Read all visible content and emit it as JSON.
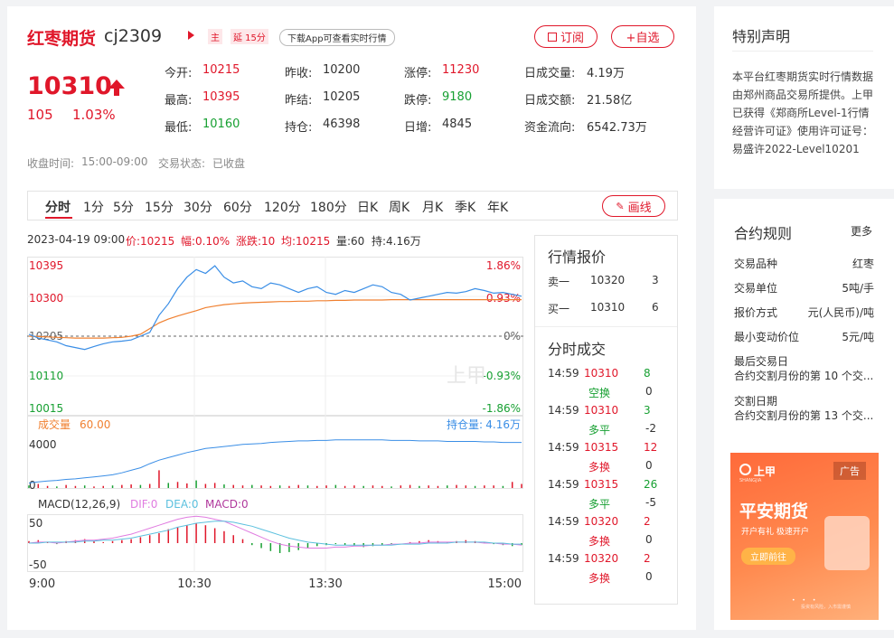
{
  "header": {
    "name": "红枣期货",
    "code": "cj2309",
    "badge_main": "主",
    "badge_delay": "延 15分",
    "download_hint": "下载App可查看实时行情",
    "subscribe_label": "订阅",
    "add_fav_label": "+自选"
  },
  "price": {
    "last": "10310",
    "change": "105",
    "change_pct": "1.03%",
    "up_color": "#e0172a",
    "down_color": "#17a032"
  },
  "stats": {
    "open_label": "今开:",
    "open": "10215",
    "prev_close_label": "昨收:",
    "prev_close": "10200",
    "limit_up_label": "涨停:",
    "limit_up": "11230",
    "volume_label": "日成交量:",
    "volume": "4.19万",
    "high_label": "最高:",
    "high": "10395",
    "prev_settle_label": "昨结:",
    "prev_settle": "10205",
    "limit_down_label": "跌停:",
    "limit_down": "9180",
    "turnover_label": "日成交额:",
    "turnover": "21.58亿",
    "low_label": "最低:",
    "low": "10160",
    "open_interest_label": "持仓:",
    "open_interest": "46398",
    "daily_inc_label": "日增:",
    "daily_inc": "4845",
    "fund_flow_label": "资金流向:",
    "fund_flow": "6542.73万"
  },
  "session": {
    "close_time_label": "收盘时间:",
    "close_time": "15:00-09:00",
    "trade_status_label": "交易状态:",
    "trade_status": "已收盘"
  },
  "tabs": [
    "分时",
    "1分",
    "5分",
    "15分",
    "30分",
    "60分",
    "120分",
    "180分",
    "日K",
    "周K",
    "月K",
    "季K",
    "年K"
  ],
  "draw_line_label": "画线",
  "info_bar": {
    "datetime": "2023-04-19 09:00",
    "price": "价:10215",
    "amplitude": "幅:0.10%",
    "change": "涨跌:10",
    "average": "均:10215",
    "volume": "量:60",
    "hold": "持:4.16万"
  },
  "chart_data": {
    "type": "line",
    "price_axis": {
      "left": [
        "10395",
        "10300",
        "10205",
        "10110",
        "10015"
      ],
      "right": [
        "1.86%",
        "0.93%",
        "0%",
        "-0.93%",
        "-1.86%"
      ],
      "ylim": [
        10015,
        10395
      ]
    },
    "x_ticks": [
      "9:00",
      "10:30",
      "13:30",
      "15:00"
    ],
    "volume_label": "成交量",
    "volume_value": "60.00",
    "hold_label": "持仓量:",
    "hold_value": "4.16万",
    "volume_axis": [
      "4000",
      "0"
    ],
    "macd_label": "MACD(12,26,9)",
    "dif_label": "DIF:0",
    "dea_label": "DEA:0",
    "macd_value_label": "MACD:0",
    "macd_axis": [
      "50",
      "-50"
    ],
    "series": [
      {
        "name": "价",
        "color": "#3a8ee6",
        "values": [
          10210,
          10200,
          10195,
          10190,
          10180,
          10175,
          10170,
          10178,
          10185,
          10190,
          10192,
          10195,
          10205,
          10215,
          10260,
          10290,
          10330,
          10360,
          10380,
          10370,
          10390,
          10360,
          10345,
          10350,
          10335,
          10330,
          10345,
          10340,
          10330,
          10320,
          10330,
          10335,
          10320,
          10315,
          10325,
          10320,
          10330,
          10340,
          10335,
          10320,
          10315,
          10300,
          10305,
          10310,
          10315,
          10320,
          10318,
          10322,
          10330,
          10325,
          10318,
          10320,
          10315,
          10310
        ]
      },
      {
        "name": "均",
        "color": "#f08030",
        "values": [
          10205,
          10204,
          10203,
          10202,
          10201,
          10200,
          10200,
          10200,
          10200,
          10201,
          10202,
          10205,
          10210,
          10225,
          10240,
          10250,
          10258,
          10265,
          10272,
          10280,
          10284,
          10288,
          10290,
          10292,
          10293,
          10294,
          10295,
          10296,
          10296,
          10297,
          10297,
          10298,
          10298,
          10299,
          10299,
          10300,
          10300,
          10300,
          10300,
          10301,
          10301,
          10301,
          10301,
          10301,
          10301,
          10301,
          10301,
          10301,
          10301,
          10301,
          10301,
          10301,
          10301,
          10301
        ]
      },
      {
        "name": "持仓量",
        "color": "#3a8ee6",
        "values": [
          0.1,
          0.12,
          0.14,
          0.15,
          0.17,
          0.18,
          0.2,
          0.22,
          0.24,
          0.26,
          0.3,
          0.35,
          0.4,
          0.48,
          0.55,
          0.6,
          0.65,
          0.7,
          0.74,
          0.78,
          0.8,
          0.82,
          0.84,
          0.86,
          0.87,
          0.88,
          0.9,
          0.91,
          0.92,
          0.93,
          0.93,
          0.94,
          0.94,
          0.95,
          0.95,
          0.95,
          0.95,
          0.95,
          0.95,
          0.94,
          0.94,
          0.94,
          0.93,
          0.93,
          0.93,
          0.92,
          0.92,
          0.92,
          0.92,
          0.91,
          0.91,
          0.9,
          0.9,
          0.9
        ]
      }
    ],
    "volume_bars": [
      0.05,
      0.08,
      0.04,
      0.03,
      0.06,
      0.04,
      0.05,
      0.03,
      0.04,
      0.05,
      0.06,
      0.07,
      0.06,
      0.08,
      0.35,
      0.1,
      0.12,
      0.09,
      0.15,
      0.08,
      0.1,
      0.07,
      0.06,
      0.05,
      0.06,
      0.05,
      0.04,
      0.05,
      0.04,
      0.06,
      0.05,
      0.04,
      0.05,
      0.06,
      0.04,
      0.05,
      0.04,
      0.05,
      0.04,
      0.03,
      0.05,
      0.06,
      0.04,
      0.05,
      0.04,
      0.05,
      0.06,
      0.05,
      0.04,
      0.05,
      0.05,
      0.04,
      0.12,
      0.08
    ],
    "macd_bars": [
      2,
      3,
      1,
      -1,
      2,
      3,
      4,
      2,
      1,
      2,
      3,
      4,
      6,
      8,
      10,
      14,
      16,
      18,
      20,
      18,
      15,
      12,
      8,
      4,
      -2,
      -5,
      -8,
      -10,
      -9,
      -7,
      -5,
      -3,
      -2,
      -1,
      -2,
      -3,
      -4,
      -3,
      -2,
      -1,
      0,
      1,
      2,
      3,
      2,
      1,
      2,
      3,
      2,
      1,
      -1,
      -2,
      -3,
      -2
    ],
    "dif": [
      0,
      1,
      1,
      0,
      1,
      2,
      3,
      3,
      4,
      5,
      7,
      9,
      12,
      15,
      18,
      21,
      24,
      26,
      27,
      26,
      24,
      22,
      18,
      14,
      10,
      6,
      2,
      -1,
      -3,
      -4,
      -5,
      -5,
      -5,
      -4,
      -4,
      -3,
      -3,
      -2,
      -2,
      -1,
      -1,
      0,
      0,
      1,
      1,
      1,
      1,
      1,
      1,
      0,
      0,
      -1,
      -1,
      -2
    ],
    "dea": [
      0,
      0,
      1,
      1,
      1,
      1,
      2,
      2,
      3,
      3,
      4,
      5,
      7,
      9,
      11,
      13,
      16,
      18,
      20,
      21,
      22,
      22,
      21,
      19,
      17,
      14,
      11,
      8,
      5,
      3,
      1,
      0,
      -1,
      -2,
      -2,
      -2,
      -2,
      -2,
      -2,
      -2,
      -1,
      -1,
      -1,
      0,
      0,
      0,
      1,
      1,
      1,
      1,
      0,
      0,
      -1,
      -1
    ]
  },
  "quote": {
    "title": "行情报价",
    "sell_label": "卖一",
    "sell_price": "10320",
    "sell_qty": "3",
    "buy_label": "买一",
    "buy_price": "10310",
    "buy_qty": "6"
  },
  "trades": {
    "title": "分时成交",
    "rows": [
      {
        "time": "14:59",
        "price": "10310",
        "qty": "8",
        "type": "空换",
        "oi": "0",
        "qtyColor": "green",
        "typeColor": "green"
      },
      {
        "time": "14:59",
        "price": "10310",
        "qty": "3",
        "type": "多平",
        "oi": "-2",
        "qtyColor": "green",
        "typeColor": "green"
      },
      {
        "time": "14:59",
        "price": "10315",
        "qty": "12",
        "type": "多换",
        "oi": "0",
        "qtyColor": "red",
        "typeColor": "red"
      },
      {
        "time": "14:59",
        "price": "10315",
        "qty": "26",
        "type": "多平",
        "oi": "-5",
        "qtyColor": "green",
        "typeColor": "green"
      },
      {
        "time": "14:59",
        "price": "10320",
        "qty": "2",
        "type": "多换",
        "oi": "0",
        "qtyColor": "red",
        "typeColor": "red"
      },
      {
        "time": "14:59",
        "price": "10320",
        "qty": "2",
        "type": "多换",
        "oi": "0",
        "qtyColor": "red",
        "typeColor": "red"
      }
    ]
  },
  "disclaimer": {
    "title": "特别声明",
    "text": "本平台红枣期货实时行情数据由郑州商品交易所提供。上甲已获得《郑商所Level-1行情经营许可证》使用许可证号：易盛许2022-Level10201"
  },
  "rules": {
    "title": "合约规则",
    "more": "更多",
    "rows": [
      {
        "label": "交易品种",
        "value": "红枣"
      },
      {
        "label": "交易单位",
        "value": "5吨/手"
      },
      {
        "label": "报价方式",
        "value": "元(人民币)/吨"
      },
      {
        "label": "最小变动价位",
        "value": "5元/吨"
      }
    ],
    "last_trade_label": "最后交易日",
    "last_trade_value": "合约交割月份的第 10 个交...",
    "delivery_label": "交割日期",
    "delivery_value": "合约交割月份的第 13 个交..."
  },
  "ad": {
    "brand": "上甲",
    "brand_sub": "SHANGJIA",
    "tag": "广告",
    "title": "平安期货",
    "subtitle": "开户有礼 极速开户",
    "cta": "立即前往",
    "footer": "投资有风险，入市需谨慎"
  },
  "watermark": "上甲"
}
